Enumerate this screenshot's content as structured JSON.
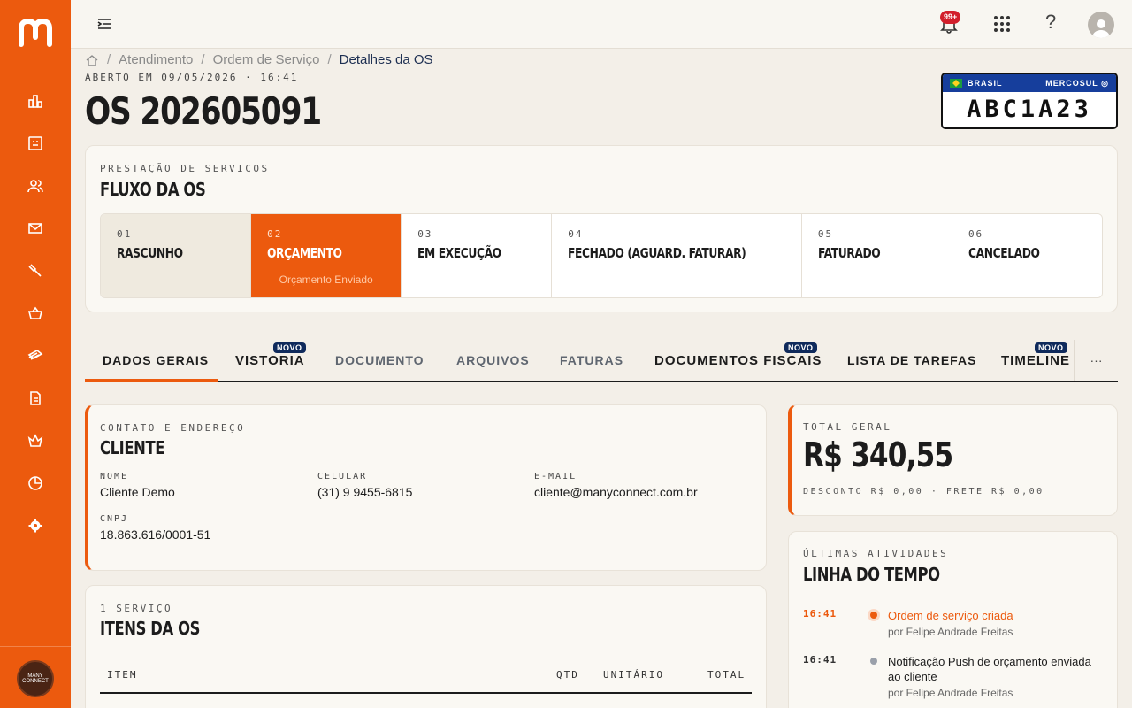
{
  "sidebar": {
    "items": [
      "dashboard",
      "kanban",
      "customers",
      "messages",
      "service-orders",
      "sales",
      "vehicles",
      "documents",
      "products",
      "reports",
      "settings"
    ],
    "avatar_text": "MANY CONNECT"
  },
  "topbar": {
    "notifications_badge": "99+",
    "help": "?"
  },
  "breadcrumb": {
    "items": [
      "Atendimento",
      "Ordem de Serviço",
      "Detalhes da OS"
    ]
  },
  "header": {
    "opened_at": "ABERTO EM 09/05/2026 · 16:41",
    "title": "OS 202605091"
  },
  "plate": {
    "country": "BRASIL",
    "block": "MERCOSUL",
    "number": "ABC1A23"
  },
  "flow": {
    "eyebrow": "PRESTAÇÃO DE SERVIÇOS",
    "title": "FLUXO DA OS",
    "steps": [
      {
        "num": "01",
        "label": "RASCUNHO",
        "state": "done"
      },
      {
        "num": "02",
        "label": "ORÇAMENTO",
        "sub": "Orçamento Enviado",
        "state": "active"
      },
      {
        "num": "03",
        "label": "EM EXECUÇÃO",
        "state": "pending"
      },
      {
        "num": "04",
        "label": "FECHADO (AGUARD. FATURAR)",
        "state": "pending"
      },
      {
        "num": "05",
        "label": "FATURADO",
        "state": "pending"
      },
      {
        "num": "06",
        "label": "CANCELADO",
        "state": "pending"
      }
    ]
  },
  "tabs": {
    "items": [
      "DADOS GERAIS",
      "VISTORIA",
      "DOCUMENTO",
      "ARQUIVOS",
      "FATURAS",
      "DOCUMENTOS FISCAIS",
      "LISTA DE TAREFAS",
      "TIMELINE"
    ],
    "new_tag": "NOVO",
    "more": "···"
  },
  "client": {
    "eyebrow": "CONTATO E ENDEREÇO",
    "title": "CLIENTE",
    "name_label": "NOME",
    "name": "Cliente Demo",
    "phone_label": "CELULAR",
    "phone": "(31) 9 9455-6815",
    "email_label": "E-MAIL",
    "email": "cliente@manyconnect.com.br",
    "cnpj_label": "CNPJ",
    "cnpj": "18.863.616/0001-51"
  },
  "items": {
    "eyebrow": "1 SERVIÇO",
    "title": "ITENS DA OS",
    "columns": [
      "ITEM",
      "QTD",
      "UNITÁRIO",
      "TOTAL"
    ]
  },
  "total": {
    "eyebrow": "TOTAL GERAL",
    "value": "R$ 340,55",
    "details": "DESCONTO R$ 0,00 · FRETE R$ 0,00"
  },
  "timeline": {
    "eyebrow": "ÚLTIMAS ATIVIDADES",
    "title": "LINHA DO TEMPO",
    "events": [
      {
        "time": "16:41",
        "text": "Ordem de serviço criada",
        "by": "por Felipe Andrade Freitas",
        "highlight": true
      },
      {
        "time": "16:41",
        "text": "Notificação Push de orçamento enviada ao cliente",
        "by": "por Felipe Andrade Freitas",
        "highlight": false
      }
    ]
  },
  "colors": {
    "accent": "#ec5a0e",
    "navy": "#0f2a5c",
    "plate_blue": "#163e9c"
  }
}
